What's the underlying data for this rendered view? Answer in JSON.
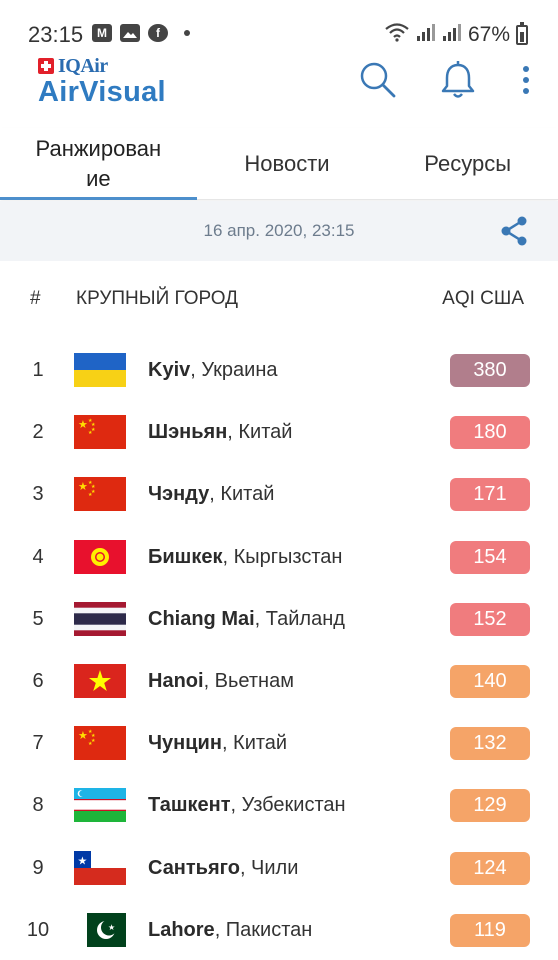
{
  "status_bar": {
    "time": "23:15",
    "battery": "67%",
    "left_icons": [
      "gmail-icon",
      "gallery-icon",
      "facebook-icon",
      "dot-icon"
    ],
    "right_icons": [
      "wifi-icon",
      "signal-icon",
      "signal-icon",
      "battery-icon"
    ]
  },
  "header": {
    "brand_small": "IQAir",
    "brand_large": "AirVisual",
    "brand_color": "#2f7bc1",
    "actions": [
      "search-icon",
      "bell-icon",
      "more-vert-icon"
    ]
  },
  "tabs": [
    {
      "label": "Ранжирован\nие",
      "active": true
    },
    {
      "label": "Новости",
      "active": false
    },
    {
      "label": "Ресурсы",
      "active": false
    }
  ],
  "date_bar": {
    "date": "16 апр. 2020, 23:15",
    "share_icon": "share-icon"
  },
  "table": {
    "col_rank": "#",
    "col_city": "КРУПНЫЙ ГОРОД",
    "col_aqi": "AQI США",
    "rows": [
      {
        "rank": "1",
        "city": "Kyiv",
        "country": ", Украина",
        "aqi": "380",
        "flag": "ukraine",
        "color": "#b17e8c"
      },
      {
        "rank": "2",
        "city": "Шэньян",
        "country": ", Китай",
        "aqi": "180",
        "flag": "china",
        "color": "#f07c7e"
      },
      {
        "rank": "3",
        "city": "Чэнду",
        "country": ", Китай",
        "aqi": "171",
        "flag": "china",
        "color": "#f07c7e"
      },
      {
        "rank": "4",
        "city": "Бишкек",
        "country": ", Кыргызстан",
        "aqi": "154",
        "flag": "kyrgyzstan",
        "color": "#f07c7e"
      },
      {
        "rank": "5",
        "city": "Chiang Mai",
        "country": ", Тайланд",
        "aqi": "152",
        "flag": "thailand",
        "color": "#f07c7e"
      },
      {
        "rank": "6",
        "city": "Hanoi",
        "country": ", Вьетнам",
        "aqi": "140",
        "flag": "vietnam",
        "color": "#f5a468"
      },
      {
        "rank": "7",
        "city": "Чунцин",
        "country": ", Китай",
        "aqi": "132",
        "flag": "china",
        "color": "#f5a468"
      },
      {
        "rank": "8",
        "city": "Ташкент",
        "country": ", Узбекистан",
        "aqi": "129",
        "flag": "uzbekistan",
        "color": "#f5a468"
      },
      {
        "rank": "9",
        "city": "Сантьяго",
        "country": ", Чили",
        "aqi": "124",
        "flag": "chile",
        "color": "#f5a468"
      },
      {
        "rank": "10",
        "city": "Lahore",
        "country": ", Пакистан",
        "aqi": "119",
        "flag": "pakistan",
        "color": "#f5a468"
      }
    ]
  }
}
